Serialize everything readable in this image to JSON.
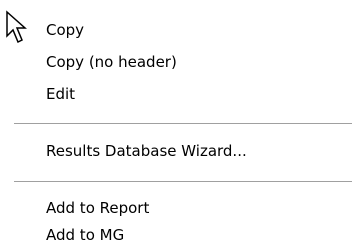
{
  "context_menu": {
    "groups": [
      [
        "Copy",
        "Copy (no header)",
        "Edit"
      ],
      [
        "Results Database Wizard..."
      ],
      [
        "Add to Report",
        "Add to MG"
      ]
    ]
  },
  "cursor": {
    "icon": "arrow-pointer-icon"
  }
}
